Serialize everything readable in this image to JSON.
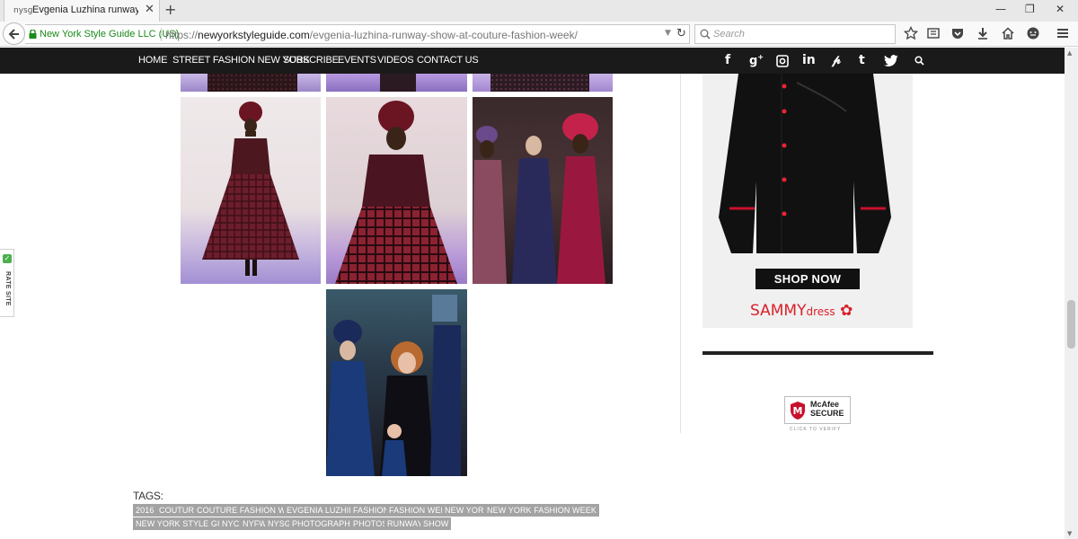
{
  "browser": {
    "tab_title": "Evgenia Luzhina runway s...",
    "tab_favicon": "nysg",
    "tab_close": "✕",
    "new_tab": "+",
    "identity": "New York Style Guide LLC (US)",
    "url_prefix": "https://",
    "url_domain": "newyorkstyleguide.com",
    "url_path": "/evgenia-luzhina-runway-show-at-couture-fashion-week/",
    "search_placeholder": "Search",
    "icons": [
      "bookmark-star-icon",
      "reading-list-icon",
      "pocket-icon",
      "download-icon",
      "home-icon",
      "chat-icon",
      "menu-icon"
    ]
  },
  "site_nav": {
    "items": [
      "HOME",
      "STREET FASHION NEW YORK",
      "SUBSCRIBE",
      "EVENTS",
      "VIDEOS",
      "CONTACT US"
    ],
    "social": [
      "f",
      "g+",
      "instagram",
      "in",
      "p",
      "t",
      "twitter",
      "search"
    ]
  },
  "gallery": {
    "photos": [
      {
        "name": "top-partial-1"
      },
      {
        "name": "top-partial-2"
      },
      {
        "name": "top-partial-3"
      },
      {
        "name": "runway-red-dress-full"
      },
      {
        "name": "runway-red-dress-closeup"
      },
      {
        "name": "three-models-finale"
      },
      {
        "name": "designer-with-models"
      }
    ]
  },
  "tags": {
    "label": "TAGS:",
    "row1": [
      "2016",
      "COUTURE",
      "COUTURE FASHION WEEK",
      "EVGENIA LUZHINA",
      "FASHION",
      "FASHION WEEK",
      "NEW YORK",
      "NEW YORK FASHION WEEK"
    ],
    "row2": [
      "NEW YORK STYLE GUIDE",
      "NYC",
      "NYFW",
      "NYSG",
      "PHOTOGRAPHER",
      "PHOTOS",
      "RUNWAY",
      "SHOW"
    ]
  },
  "sidebar": {
    "ad_button": "SHOP NOW",
    "ad_brand_big": "SAMMY",
    "ad_brand_small": "dress",
    "mcafee_line1": "McAfee",
    "mcafee_line2": "SECURE",
    "mcafee_click": "CLICK TO VERIFY"
  },
  "rate_site": {
    "label": "RATE SITE"
  },
  "colors": {
    "nav_bg": "#1a1a1a",
    "tag_bg": "#a3a3a3",
    "brand_red": "#d9212a",
    "secure_green": "#1a8a1a"
  }
}
